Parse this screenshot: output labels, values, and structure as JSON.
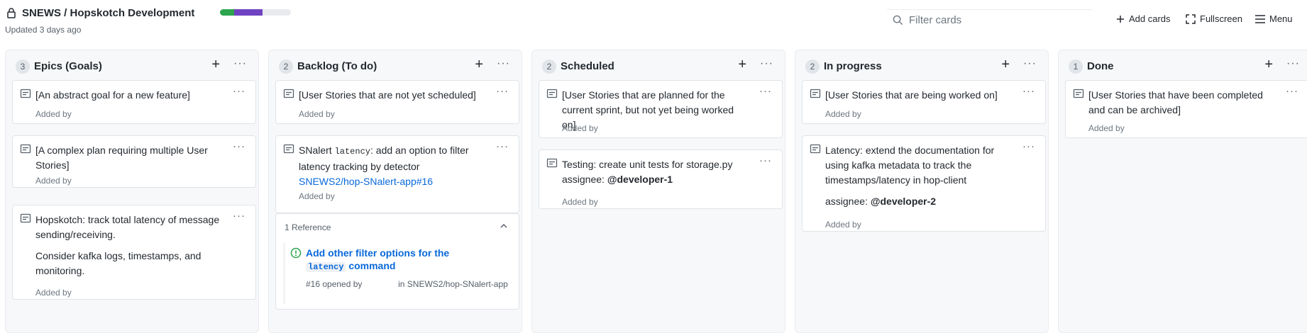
{
  "project": {
    "title": "SNEWS / Hopskotch Development",
    "updated": "Updated 3 days ago",
    "progress": {
      "done_fraction": 0.2,
      "in_progress_fraction": 0.4,
      "colors": {
        "done": "#2da44e",
        "in_progress": "#6f42c1"
      }
    }
  },
  "toolbar": {
    "search_placeholder": "Filter cards",
    "add_cards": "Add cards",
    "fullscreen": "Fullscreen",
    "menu": "Menu"
  },
  "columns": [
    {
      "count": "3",
      "title": "Epics (Goals)",
      "cards": [
        {
          "text": "[An abstract goal for a new feature]",
          "added": "Added by"
        },
        {
          "text": "[A complex plan requiring multiple User Stories]",
          "added": "Added by"
        },
        {
          "text": "Hopskotch: track total latency of message sending/receiving.",
          "text2": "Consider kafka logs, timestamps, and monitoring.",
          "added": "Added by"
        }
      ]
    },
    {
      "count": "2",
      "title": "Backlog (To do)",
      "cards": [
        {
          "text": "[User Stories that are not yet scheduled]",
          "added": "Added by"
        },
        {
          "text_prefix": "SNalert",
          "text_code": "latency",
          "text_suffix": ": add an option to filter latency tracking by detector",
          "link": "SNEWS2/hop-SNalert-app#16",
          "added": "Added by"
        }
      ],
      "reference": {
        "header": "1 Reference",
        "title_prefix": "Add other filter options for the",
        "title_code": "latency",
        "title_suffix": "command",
        "meta_number": "#16 opened by",
        "meta_repo": "in SNEWS2/hop-SNalert-app"
      }
    },
    {
      "count": "2",
      "title": "Scheduled",
      "cards": [
        {
          "text": "[User Stories that are planned for the current sprint, but not yet being worked on]",
          "added": "Added by"
        },
        {
          "text": "Testing: create unit tests for storage.py",
          "assignee_label": "assignee:",
          "assignee": "@developer-1",
          "added": "Added by"
        }
      ]
    },
    {
      "count": "2",
      "title": "In progress",
      "cards": [
        {
          "text": "[User Stories that are being worked on]",
          "added": "Added by"
        },
        {
          "text": "Latency: extend the documentation for using kafka metadata to track the timestamps/latency in hop-client",
          "assignee_label": "assignee:",
          "assignee": "@developer-2",
          "added": "Added by"
        }
      ]
    },
    {
      "count": "1",
      "title": "Done",
      "cards": [
        {
          "text": "[User Stories that have been completed and can be archived]",
          "added": "Added by"
        }
      ]
    }
  ],
  "ui": {
    "column_add": "+",
    "more": "···"
  }
}
